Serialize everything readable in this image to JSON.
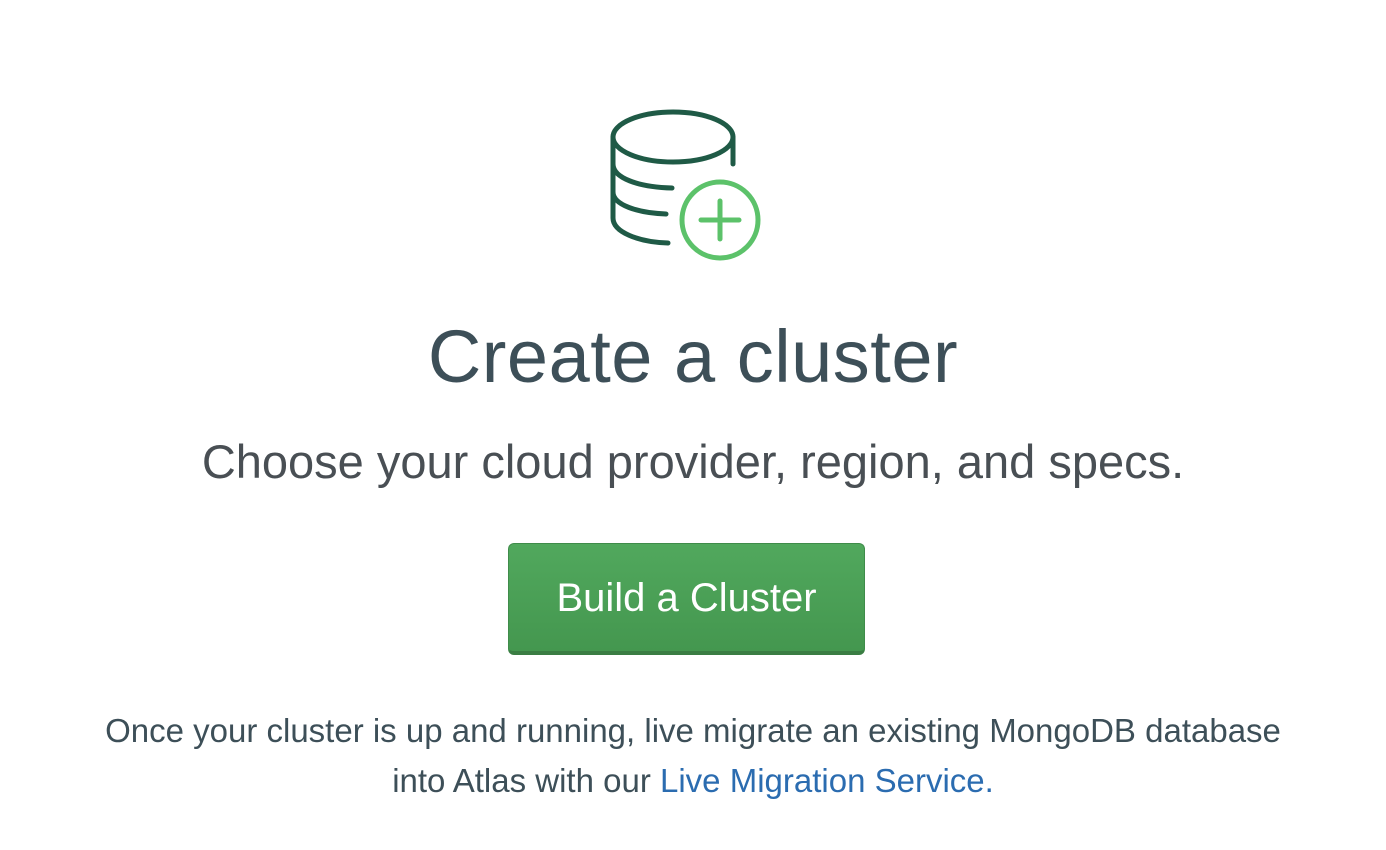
{
  "empty_state": {
    "icon": "database-plus-icon",
    "title": "Create a cluster",
    "subtitle": "Choose your cloud provider, region, and specs.",
    "build_button_label": "Build a Cluster",
    "note_line1": "Once your cluster is up and running, live migrate an existing MongoDB database",
    "note_line2_prefix": "into Atlas with our ",
    "note_link_label": "Live Migration Service",
    "note_suffix": "."
  },
  "colors": {
    "icon_stroke": "#1f5a46",
    "icon_accent": "#5cc26a",
    "button_green": "#4aa057",
    "link_blue": "#2b6cb0",
    "title_text": "#3d4f58"
  }
}
